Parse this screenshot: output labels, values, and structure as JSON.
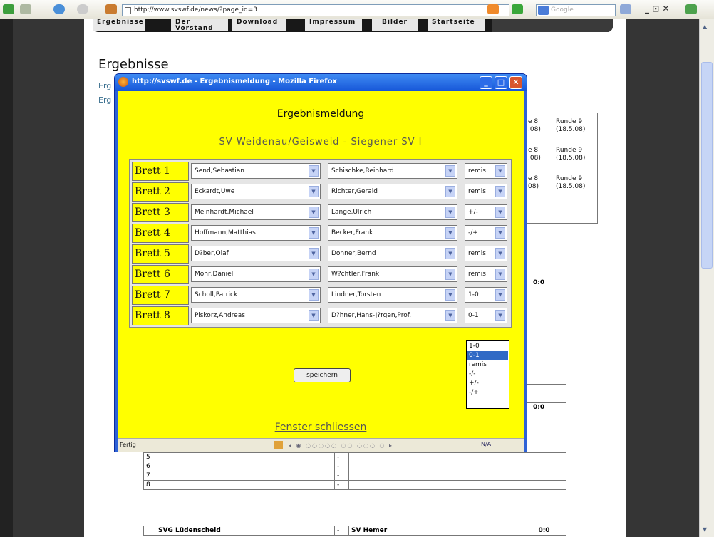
{
  "browser": {
    "url": "http://www.svswf.de/news/?page_id=3",
    "search_placeholder": "Google"
  },
  "site": {
    "nav": [
      "Ergebnisse",
      "Der Vorstand",
      "Download",
      "Impressum",
      "Bilder",
      "Startseite"
    ],
    "heading": "Ergebnisse",
    "links": [
      "Erg",
      "Erg"
    ]
  },
  "side_table": {
    "rows": [
      [
        "e 8",
        "Runde 9"
      ],
      [
        ".08)",
        "(18.5.08)"
      ],
      [
        "e 8",
        "Runde 9"
      ],
      [
        ".08)",
        "(18.5.08)"
      ],
      [
        "e 8",
        "Runde 9"
      ],
      [
        "08)",
        "(18.5.08)"
      ]
    ]
  },
  "bg_table1": {
    "score": "0:0"
  },
  "bg_table2": {
    "score": "0:0",
    "numbers": [
      "5",
      "6",
      "7",
      "8"
    ],
    "dash": "-"
  },
  "bg_table3": {
    "home": "SVG Lüdenscheid",
    "dash": "-",
    "away": "SV Hemer",
    "score": "0:0"
  },
  "popup": {
    "window_title": "http://svswf.de - Ergebnismeldung - Mozilla Firefox",
    "title": "Ergebnismeldung",
    "match": "SV Weidenau/Geisweid - Siegener SV I",
    "boards": [
      {
        "label": "Brett 1",
        "home": "Send,Sebastian",
        "away": "Schischke,Reinhard",
        "result": "remis"
      },
      {
        "label": "Brett 2",
        "home": "Eckardt,Uwe",
        "away": "Richter,Gerald",
        "result": "remis"
      },
      {
        "label": "Brett 3",
        "home": "Meinhardt,Michael",
        "away": "Lange,Ulrich",
        "result": "+/-"
      },
      {
        "label": "Brett 4",
        "home": "Hoffmann,Matthias",
        "away": "Becker,Frank",
        "result": "-/+"
      },
      {
        "label": "Brett 5",
        "home": "D?ber,Olaf",
        "away": "Donner,Bernd",
        "result": "remis"
      },
      {
        "label": "Brett 6",
        "home": "Mohr,Daniel",
        "away": "W?chtler,Frank",
        "result": "remis"
      },
      {
        "label": "Brett 7",
        "home": "Scholl,Patrick",
        "away": "Lindner,Torsten",
        "result": "1-0"
      },
      {
        "label": "Brett 8",
        "home": "Piskorz,Andreas",
        "away": "D?hner,Hans-J?rgen,Prof.",
        "result": "0-1"
      }
    ],
    "dropdown_options": [
      "1-0",
      "0-1",
      "remis",
      "-/-",
      "+/-",
      "-/+"
    ],
    "dropdown_highlighted": "0-1",
    "save_label": "speichern",
    "close_label": "Fenster schliessen",
    "status": "Fertig",
    "status_right": "N/A"
  },
  "colors": {
    "popup_bg": "#ffff00",
    "titlebar": "#1656d8",
    "highlight": "#316ac5"
  }
}
